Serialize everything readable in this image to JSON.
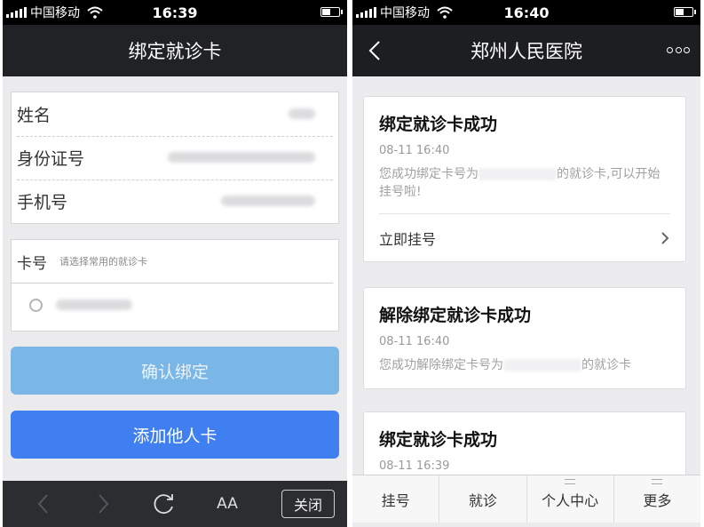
{
  "left": {
    "status": {
      "carrier": "中国移动",
      "time": "16:39"
    },
    "title": "绑定就诊卡",
    "fields": [
      {
        "label": "姓名"
      },
      {
        "label": "身份证号"
      },
      {
        "label": "手机号"
      }
    ],
    "card": {
      "label": "卡号",
      "placeholder": "请选择常用的就诊卡"
    },
    "confirm_label": "确认绑定",
    "add_label": "添加他人卡",
    "toolbar": {
      "font_label": "AA",
      "close_label": "关闭"
    }
  },
  "right": {
    "status": {
      "carrier": "中国移动",
      "time": "16:40"
    },
    "title": "郑州人民医院",
    "messages": [
      {
        "title": "绑定就诊卡成功",
        "time": "08-11 16:40",
        "body_pre": "您成功绑定卡号为",
        "body_post": "的就诊卡,可以开始挂号啦!",
        "action": "立即挂号"
      },
      {
        "title": "解除绑定就诊卡成功",
        "time": "08-11 16:40",
        "body_pre": "您成功解除绑定卡号为",
        "body_post": "的就诊卡"
      },
      {
        "title": "绑定就诊卡成功",
        "time": "08-11 16:39"
      }
    ],
    "tabs": [
      "挂号",
      "就诊",
      "个人中心",
      "更多"
    ]
  },
  "colors": {
    "confirm": "#7ab7e6",
    "add": "#3f7ff0",
    "navbar": "#1c1e22"
  }
}
